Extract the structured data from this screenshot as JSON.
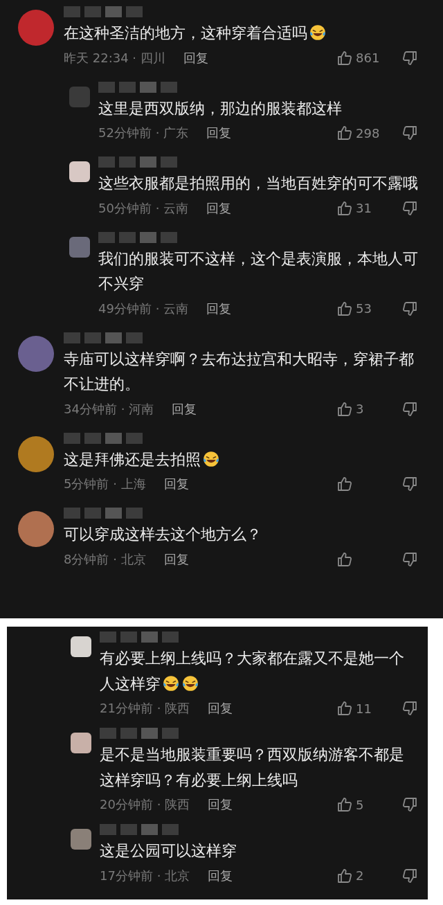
{
  "panels": [
    {
      "comments": [
        {
          "reply": false,
          "color": "#c0282d",
          "text": "在这种圣洁的地方，这种穿着合适吗",
          "emojis": [
            {
              "kind": "laugh"
            }
          ],
          "meta": "昨天 22:34 · 四川",
          "reply_label": "回复",
          "likes": "861"
        },
        {
          "reply": true,
          "color": "#3a3a3a",
          "text": "这里是西双版纳，那边的服装都这样",
          "meta": "52分钟前 · 广东",
          "reply_label": "回复",
          "likes": "298"
        },
        {
          "reply": true,
          "color": "#d8c8c4",
          "text": "这些衣服都是拍照用的，当地百姓穿的可不露哦",
          "meta": "50分钟前 · 云南",
          "reply_label": "回复",
          "likes": "31"
        },
        {
          "reply": true,
          "color": "#6a6a7a",
          "text": "我们的服装可不这样，这个是表演服，本地人可不兴穿",
          "meta": "49分钟前 · 云南",
          "reply_label": "回复",
          "likes": "53"
        },
        {
          "reply": false,
          "color": "#6a6090",
          "text": "寺庙可以这样穿啊？去布达拉宫和大昭寺，穿裙子都不让进的。",
          "meta": "34分钟前 · 河南",
          "reply_label": "回复",
          "likes": "3"
        },
        {
          "reply": false,
          "color": "#b07a20",
          "text": "这是拜佛还是去拍照",
          "emojis": [
            {
              "kind": "laugh"
            }
          ],
          "meta": "5分钟前 · 上海",
          "reply_label": "回复"
        },
        {
          "reply": false,
          "color": "#b07050",
          "text": "可以穿成这样去这个地方么？",
          "meta": "8分钟前 · 北京",
          "reply_label": "回复"
        }
      ]
    },
    {
      "comments": [
        {
          "reply": true,
          "color": "#d8d4d0",
          "text": "有必要上纲上线吗？大家都在露又不是她一个人这样穿",
          "emojis": [
            {
              "kind": "laugh"
            },
            {
              "kind": "laugh"
            }
          ],
          "meta": "21分钟前 · 陕西",
          "reply_label": "回复",
          "likes": "11"
        },
        {
          "reply": true,
          "color": "#c8b0a8",
          "text": "是不是当地服装重要吗？西双版纳游客不都是这样穿吗？有必要上纲上线吗",
          "meta": "20分钟前 · 陕西",
          "reply_label": "回复",
          "likes": "5"
        },
        {
          "reply": true,
          "color": "#8a8078",
          "text": "这是公园可以这样穿",
          "meta": "17分钟前 · 北京",
          "reply_label": "回复",
          "likes": "2"
        }
      ]
    }
  ]
}
